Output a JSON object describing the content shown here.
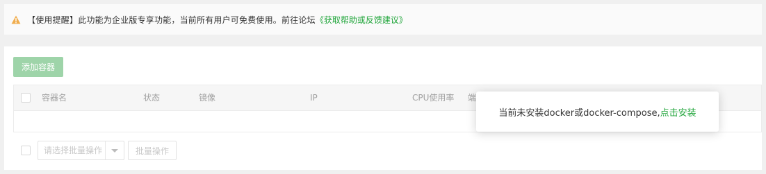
{
  "colors": {
    "accent": "#20a53a",
    "warning": "#f0ad4e",
    "button_disabled": "#9ed4a9"
  },
  "notice": {
    "icon": "warning-triangle-icon",
    "text": "【使用提醒】此功能为企业版专享功能，当前所有用户可免费使用。前往论坛",
    "link": "《获取帮助或反馈建议》"
  },
  "toolbar": {
    "add_container_label": "添加容器"
  },
  "table": {
    "headers": [
      "容器名",
      "状态",
      "镜像",
      "IP",
      "CPU使用率",
      "端"
    ]
  },
  "footer": {
    "batch_select_placeholder": "请选择批量操作",
    "batch_button_label": "批量操作"
  },
  "popup": {
    "message": "当前未安装docker或docker-compose,",
    "link": "点击安装"
  }
}
